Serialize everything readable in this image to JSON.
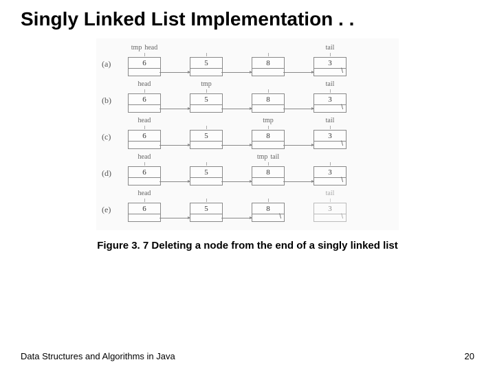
{
  "title": "Singly Linked List Implementation . .",
  "caption": "Figure 3. 7 Deleting a node from the end of a singly linked list",
  "footer_left": "Data Structures and Algorithms in Java",
  "footer_right": "20",
  "labels": {
    "head": "head",
    "tail": "tail",
    "tmp": "tmp",
    "null": "\\"
  },
  "rows": [
    {
      "id": "(a)",
      "nodes": [
        {
          "value": "6",
          "ptr_null": false,
          "labels": [
            "tmp",
            "head"
          ]
        },
        {
          "value": "5",
          "ptr_null": false,
          "labels": []
        },
        {
          "value": "8",
          "ptr_null": false,
          "labels": []
        },
        {
          "value": "3",
          "ptr_null": true,
          "labels": [
            "tail"
          ]
        }
      ],
      "arrows": [
        [
          0,
          1
        ],
        [
          1,
          2
        ],
        [
          2,
          3
        ]
      ]
    },
    {
      "id": "(b)",
      "nodes": [
        {
          "value": "6",
          "ptr_null": false,
          "labels": [
            "head"
          ]
        },
        {
          "value": "5",
          "ptr_null": false,
          "labels": [
            "tmp"
          ]
        },
        {
          "value": "8",
          "ptr_null": false,
          "labels": []
        },
        {
          "value": "3",
          "ptr_null": true,
          "labels": [
            "tail"
          ]
        }
      ],
      "arrows": [
        [
          0,
          1
        ],
        [
          1,
          2
        ],
        [
          2,
          3
        ]
      ]
    },
    {
      "id": "(c)",
      "nodes": [
        {
          "value": "6",
          "ptr_null": false,
          "labels": [
            "head"
          ]
        },
        {
          "value": "5",
          "ptr_null": false,
          "labels": []
        },
        {
          "value": "8",
          "ptr_null": false,
          "labels": [
            "tmp"
          ]
        },
        {
          "value": "3",
          "ptr_null": true,
          "labels": [
            "tail"
          ]
        }
      ],
      "arrows": [
        [
          0,
          1
        ],
        [
          1,
          2
        ],
        [
          2,
          3
        ]
      ]
    },
    {
      "id": "(d)",
      "nodes": [
        {
          "value": "6",
          "ptr_null": false,
          "labels": [
            "head"
          ]
        },
        {
          "value": "5",
          "ptr_null": false,
          "labels": []
        },
        {
          "value": "8",
          "ptr_null": false,
          "labels": [
            "tmp",
            "tail"
          ]
        },
        {
          "value": "3",
          "ptr_null": true,
          "labels": []
        }
      ],
      "arrows": [
        [
          0,
          1
        ],
        [
          1,
          2
        ],
        [
          2,
          3
        ]
      ]
    },
    {
      "id": "(e)",
      "nodes": [
        {
          "value": "6",
          "ptr_null": false,
          "labels": [
            "head"
          ]
        },
        {
          "value": "5",
          "ptr_null": false,
          "labels": []
        },
        {
          "value": "8",
          "ptr_null": true,
          "labels": []
        },
        {
          "value": "3",
          "ptr_null": true,
          "labels": [
            "tail"
          ],
          "faint": true
        }
      ],
      "arrows": [
        [
          0,
          1
        ],
        [
          1,
          2
        ]
      ]
    }
  ]
}
